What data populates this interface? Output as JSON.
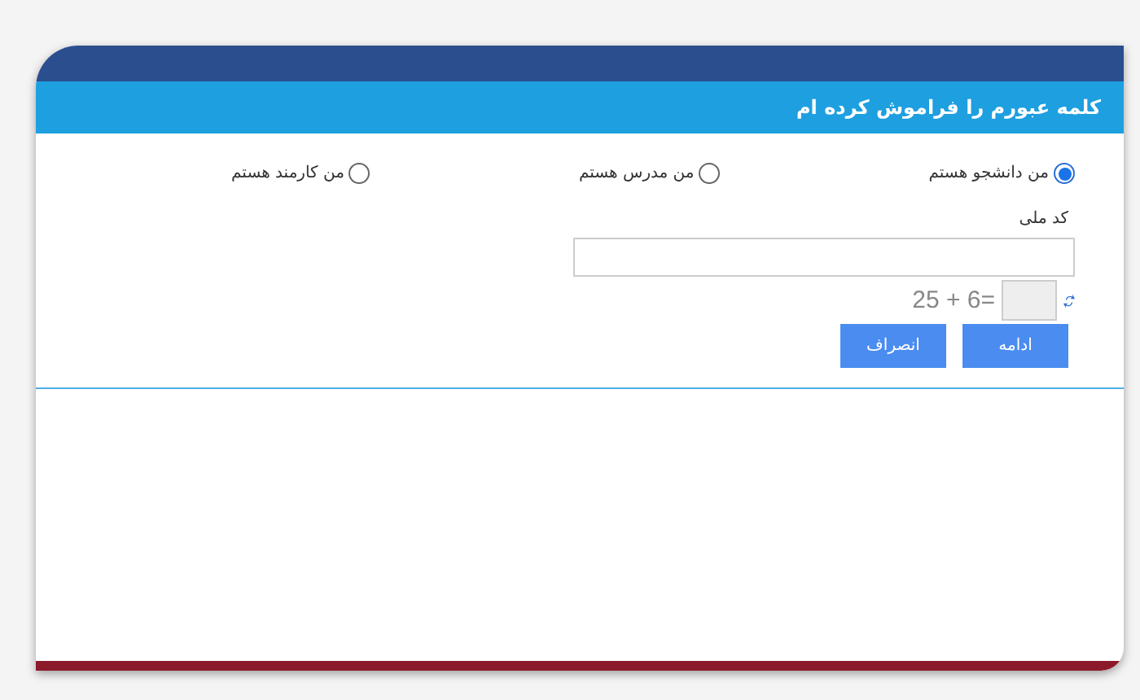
{
  "header": {
    "title": "کلمه عبورم را فراموش کرده ام"
  },
  "roles": [
    {
      "label": "من دانشجو هستم",
      "selected": true
    },
    {
      "label": "من مدرس هستم",
      "selected": false
    },
    {
      "label": "من کارمند هستم",
      "selected": false
    }
  ],
  "national_code": {
    "label": "کد ملی"
  },
  "captcha": {
    "text": "25 + 6="
  },
  "buttons": [
    "ادامه",
    "انصراف"
  ]
}
